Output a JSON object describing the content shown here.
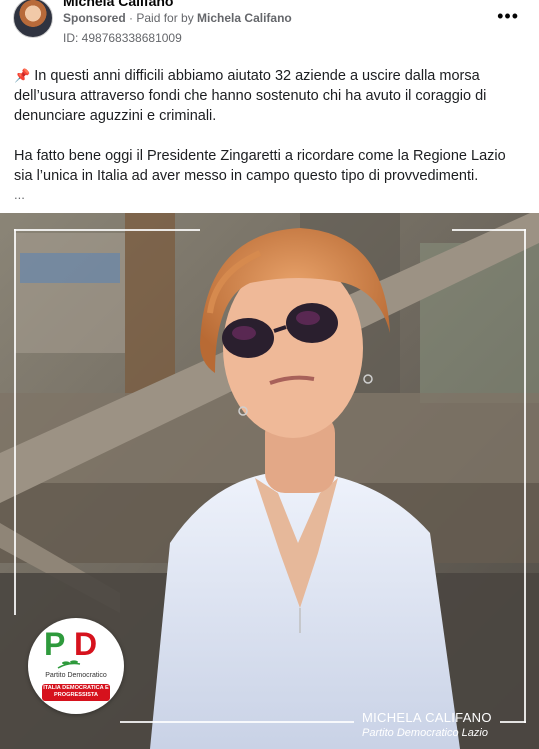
{
  "post": {
    "page_name": "Michela Califano",
    "sponsored": "Sponsored",
    "separator": " · ",
    "paid_for_prefix": "Paid for by ",
    "paid_for_name": "Michela Califano",
    "ad_id": "ID: 498768338681009",
    "more_label": "•••",
    "pin_icon": "📌",
    "paragraph_1": "In questi anni difficili abbiamo aiutato 32 aziende a uscire dalla morsa dell’usura attraverso fondi che hanno sostenuto chi ha avuto il coraggio di denunciare aguzzini e criminali.",
    "paragraph_2": "Ha fatto bene oggi il Presidente Zingaretti a ricordare come la Regione Lazio sia l’unica in Italia ad aver messo in campo questo tipo di provvedimenti.",
    "ellipsis": "..."
  },
  "media": {
    "logo_letters_p": "P",
    "logo_letters_d": "D",
    "logo_party_name": "Partito Democratico",
    "logo_slogan": "ITALIA DEMOCRATICA E PROGRESSISTA",
    "signature_name": "MICHELA CALIFANO",
    "signature_party": "Partito Democratico Lazio"
  },
  "colors": {
    "pd_green": "#2e9a3c",
    "pd_red": "#d6121d",
    "meta_text": "#65676b"
  }
}
